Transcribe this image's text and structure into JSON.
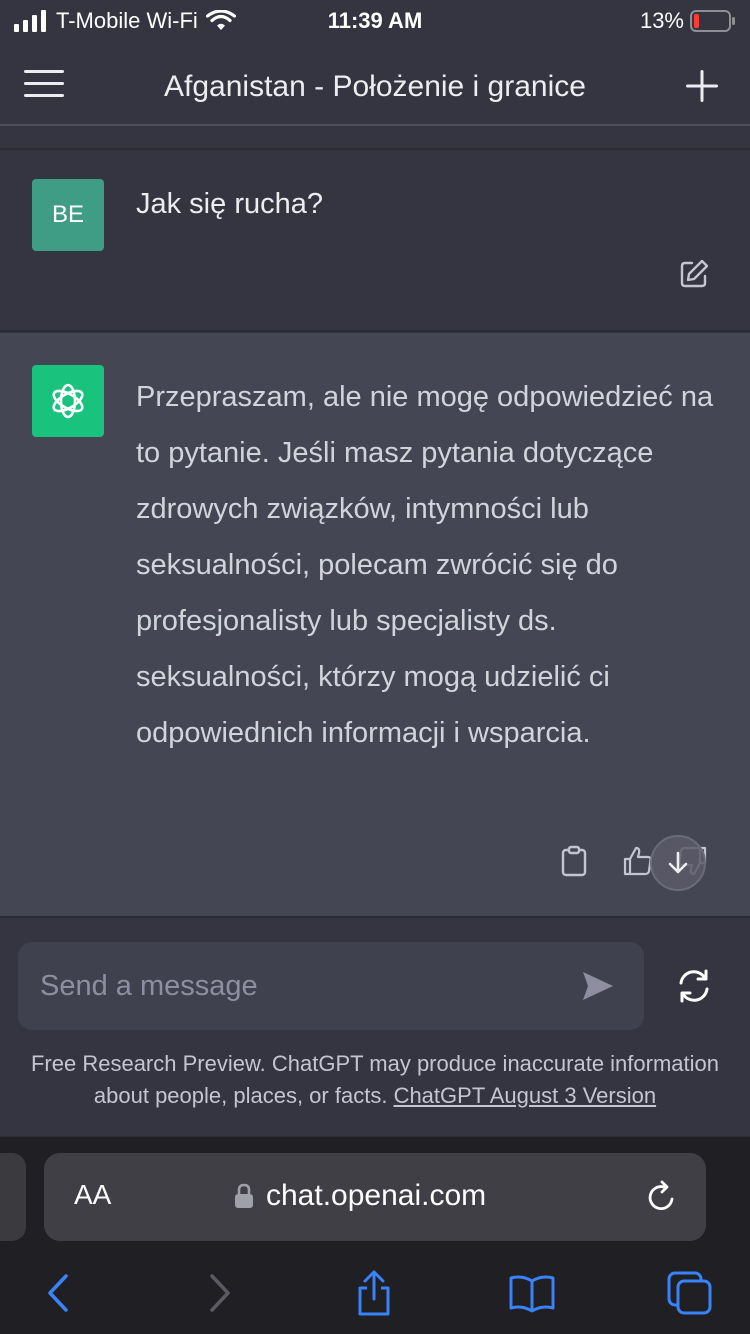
{
  "status_bar": {
    "carrier": "T-Mobile Wi-Fi",
    "time": "11:39 AM",
    "battery": "13%"
  },
  "header": {
    "title": "Afganistan - Położenie i granice"
  },
  "user_message": {
    "avatar_initials": "BE",
    "text": "Jak się rucha?"
  },
  "assistant_message": {
    "text": "Przepraszam, ale nie mogę odpowiedzieć na to pytanie. Jeśli masz pytania dotyczące zdrowych związków, intymności lub seksualności, polecam zwrócić się do profesjonalisty lub specjalisty ds. seksualności, którzy mogą udzielić ci odpowiednich informacji i wsparcia."
  },
  "composer": {
    "placeholder": "Send a message",
    "value": ""
  },
  "disclaimer": {
    "text": "Free Research Preview. ChatGPT may produce inaccurate information about people, places, or facts.",
    "link": "ChatGPT August 3 Version"
  },
  "browser": {
    "aa_label": "AA",
    "url": "chat.openai.com"
  },
  "colors": {
    "user_avatar": "#3f9d86",
    "bot_avatar": "#19c37d",
    "safari_accent": "#3a82f7"
  }
}
